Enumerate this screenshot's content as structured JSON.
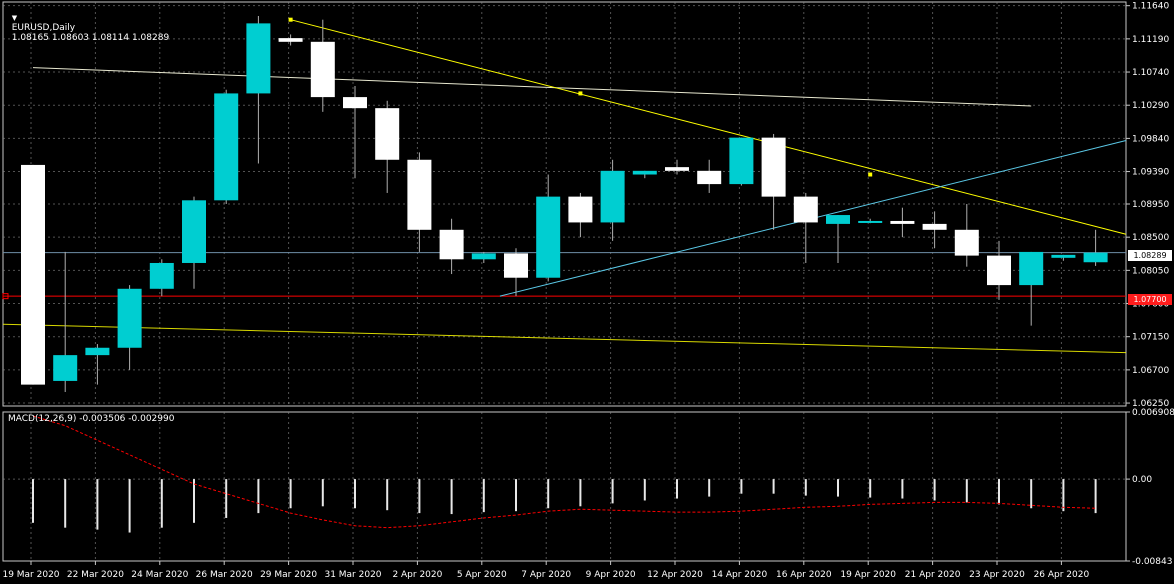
{
  "header": {
    "dropdown_icon": "triangle-down-icon",
    "symbol": "EURUSD,Daily",
    "ohlc": "1.08165 1.08603 1.08114 1.08289"
  },
  "price_tags": {
    "bid": "1.08289",
    "level": "1.07700"
  },
  "macd": {
    "label": "MACD(12,26,9) -0.003506 -0.002990",
    "scale": [
      "0.006908",
      "0.00",
      "-0.00843"
    ]
  },
  "colors": {
    "background": "#000000",
    "bull": "#00CED1",
    "bear": "#FFFFFF",
    "wick": "#B0B0B0",
    "level_line": "#FF0000",
    "trend_yellow": "#FFFF00",
    "trend_cyan": "#5BC8E6",
    "ma_light": "#E8E8D0",
    "bid_line": "#6F8FA8",
    "macd_signal": "#FF0000"
  },
  "chart_data": {
    "type": "candlestick",
    "symbol": "EURUSD",
    "timeframe": "Daily",
    "price_axis": [
      "1.11640",
      "1.11190",
      "1.10740",
      "1.10290",
      "1.09840",
      "1.09390",
      "1.08950",
      "1.08500",
      "1.08050",
      "1.07600",
      "1.07150",
      "1.06700",
      "1.06250"
    ],
    "ylim": [
      1.0621,
      1.1169
    ],
    "date_labels": [
      "19 Mar 2020",
      "22 Mar 2020",
      "24 Mar 2020",
      "26 Mar 2020",
      "29 Mar 2020",
      "31 Mar 2020",
      "2 Apr 2020",
      "5 Apr 2020",
      "7 Apr 2020",
      "9 Apr 2020",
      "12 Apr 2020",
      "14 Apr 2020",
      "16 Apr 2020",
      "19 Apr 2020",
      "21 Apr 2020",
      "23 Apr 2020",
      "26 Apr 2020"
    ],
    "candles": [
      {
        "o": 1.0948,
        "h": 1.0948,
        "l": 1.065,
        "c": 1.065
      },
      {
        "o": 1.0655,
        "h": 1.083,
        "l": 1.064,
        "c": 1.069
      },
      {
        "o": 1.069,
        "h": 1.0705,
        "l": 1.065,
        "c": 1.07
      },
      {
        "o": 1.07,
        "h": 1.0785,
        "l": 1.067,
        "c": 1.078
      },
      {
        "o": 1.078,
        "h": 1.082,
        "l": 1.077,
        "c": 1.0815
      },
      {
        "o": 1.0815,
        "h": 1.0905,
        "l": 1.078,
        "c": 1.09
      },
      {
        "o": 1.09,
        "h": 1.105,
        "l": 1.0895,
        "c": 1.1045
      },
      {
        "o": 1.1045,
        "h": 1.115,
        "l": 1.095,
        "c": 1.114
      },
      {
        "o": 1.112,
        "h": 1.1125,
        "l": 1.111,
        "c": 1.1115
      },
      {
        "o": 1.1115,
        "h": 1.1145,
        "l": 1.102,
        "c": 1.104
      },
      {
        "o": 1.104,
        "h": 1.1055,
        "l": 1.093,
        "c": 1.1025
      },
      {
        "o": 1.1025,
        "h": 1.1035,
        "l": 1.091,
        "c": 1.0955
      },
      {
        "o": 1.0955,
        "h": 1.0965,
        "l": 1.083,
        "c": 1.086
      },
      {
        "o": 1.086,
        "h": 1.0875,
        "l": 1.08,
        "c": 1.082
      },
      {
        "o": 1.082,
        "h": 1.083,
        "l": 1.0815,
        "c": 1.0828
      },
      {
        "o": 1.0828,
        "h": 1.0835,
        "l": 1.077,
        "c": 1.0795
      },
      {
        "o": 1.0795,
        "h": 1.0935,
        "l": 1.079,
        "c": 1.0905
      },
      {
        "o": 1.0905,
        "h": 1.091,
        "l": 1.085,
        "c": 1.087
      },
      {
        "o": 1.087,
        "h": 1.0955,
        "l": 1.0845,
        "c": 1.094
      },
      {
        "o": 1.0935,
        "h": 1.094,
        "l": 1.093,
        "c": 1.094
      },
      {
        "o": 1.0945,
        "h": 1.0955,
        "l": 1.0935,
        "c": 1.094
      },
      {
        "o": 1.094,
        "h": 1.0955,
        "l": 1.091,
        "c": 1.0922
      },
      {
        "o": 1.0922,
        "h": 1.0985,
        "l": 1.092,
        "c": 1.0985
      },
      {
        "o": 1.0985,
        "h": 1.099,
        "l": 1.086,
        "c": 1.0905
      },
      {
        "o": 1.0905,
        "h": 1.091,
        "l": 1.0815,
        "c": 1.087
      },
      {
        "o": 1.0868,
        "h": 1.088,
        "l": 1.0815,
        "c": 1.088
      },
      {
        "o": 1.0872,
        "h": 1.0875,
        "l": 1.0869,
        "c": 1.0872
      },
      {
        "o": 1.0872,
        "h": 1.089,
        "l": 1.085,
        "c": 1.0868
      },
      {
        "o": 1.0868,
        "h": 1.0885,
        "l": 1.0835,
        "c": 1.086
      },
      {
        "o": 1.086,
        "h": 1.0895,
        "l": 1.081,
        "c": 1.0825
      },
      {
        "o": 1.0825,
        "h": 1.0845,
        "l": 1.0765,
        "c": 1.0785
      },
      {
        "o": 1.0785,
        "h": 1.083,
        "l": 1.073,
        "c": 1.083
      },
      {
        "o": 1.0822,
        "h": 1.0826,
        "l": 1.0818,
        "c": 1.0826
      },
      {
        "o": 1.0816,
        "h": 1.086,
        "l": 1.0811,
        "c": 1.0829
      }
    ],
    "macd_histogram": [
      -0.0045,
      -0.005,
      -0.0052,
      -0.0055,
      -0.005,
      -0.0045,
      -0.004,
      -0.0035,
      -0.003,
      -0.0028,
      -0.003,
      -0.0032,
      -0.0035,
      -0.0036,
      -0.0034,
      -0.0033,
      -0.003,
      -0.0028,
      -0.0025,
      -0.0022,
      -0.002,
      -0.0018,
      -0.0015,
      -0.0015,
      -0.0017,
      -0.0018,
      -0.0019,
      -0.002,
      -0.0022,
      -0.0024,
      -0.0026,
      -0.003,
      -0.0033,
      -0.0035
    ],
    "macd_signal": [
      0.0065,
      0.0055,
      0.004,
      0.0025,
      0.001,
      -0.0005,
      -0.0015,
      -0.0025,
      -0.0035,
      -0.0042,
      -0.0048,
      -0.005,
      -0.0048,
      -0.0044,
      -0.004,
      -0.0037,
      -0.0033,
      -0.0031,
      -0.0032,
      -0.0033,
      -0.0034,
      -0.0034,
      -0.0033,
      -0.0031,
      -0.0029,
      -0.0028,
      -0.0026,
      -0.0025,
      -0.0024,
      -0.0024,
      -0.0025,
      -0.0027,
      -0.0029,
      -0.003
    ],
    "macd_ylim": [
      -0.00843,
      0.006908
    ],
    "trendlines": [
      {
        "kind": "ma_light",
        "from": {
          "bar": 0,
          "price": 1.108
        },
        "to": {
          "bar": 31,
          "price": 1.1028
        }
      },
      {
        "kind": "trend_yellow",
        "from": {
          "bar": 8,
          "price": 1.1145
        },
        "to": {
          "bar": 34.3,
          "price": 1.085
        },
        "anchors": [
          {
            "bar": 8,
            "price": 1.1145
          },
          {
            "bar": 17,
            "price": 1.1045
          },
          {
            "bar": 26,
            "price": 1.0935
          }
        ]
      },
      {
        "kind": "trend_cyan",
        "from": {
          "bar": 14.5,
          "price": 1.077
        },
        "to": {
          "bar": 34.3,
          "price": 1.0985
        }
      },
      {
        "kind": "ma_yellow",
        "from": {
          "bar": -1,
          "price": 1.0732
        },
        "to": {
          "bar": 34.3,
          "price": 1.0693
        }
      }
    ],
    "horizontal_levels": [
      {
        "kind": "level_line",
        "price": 1.077
      },
      {
        "kind": "bid_line",
        "price": 1.0829
      }
    ]
  }
}
